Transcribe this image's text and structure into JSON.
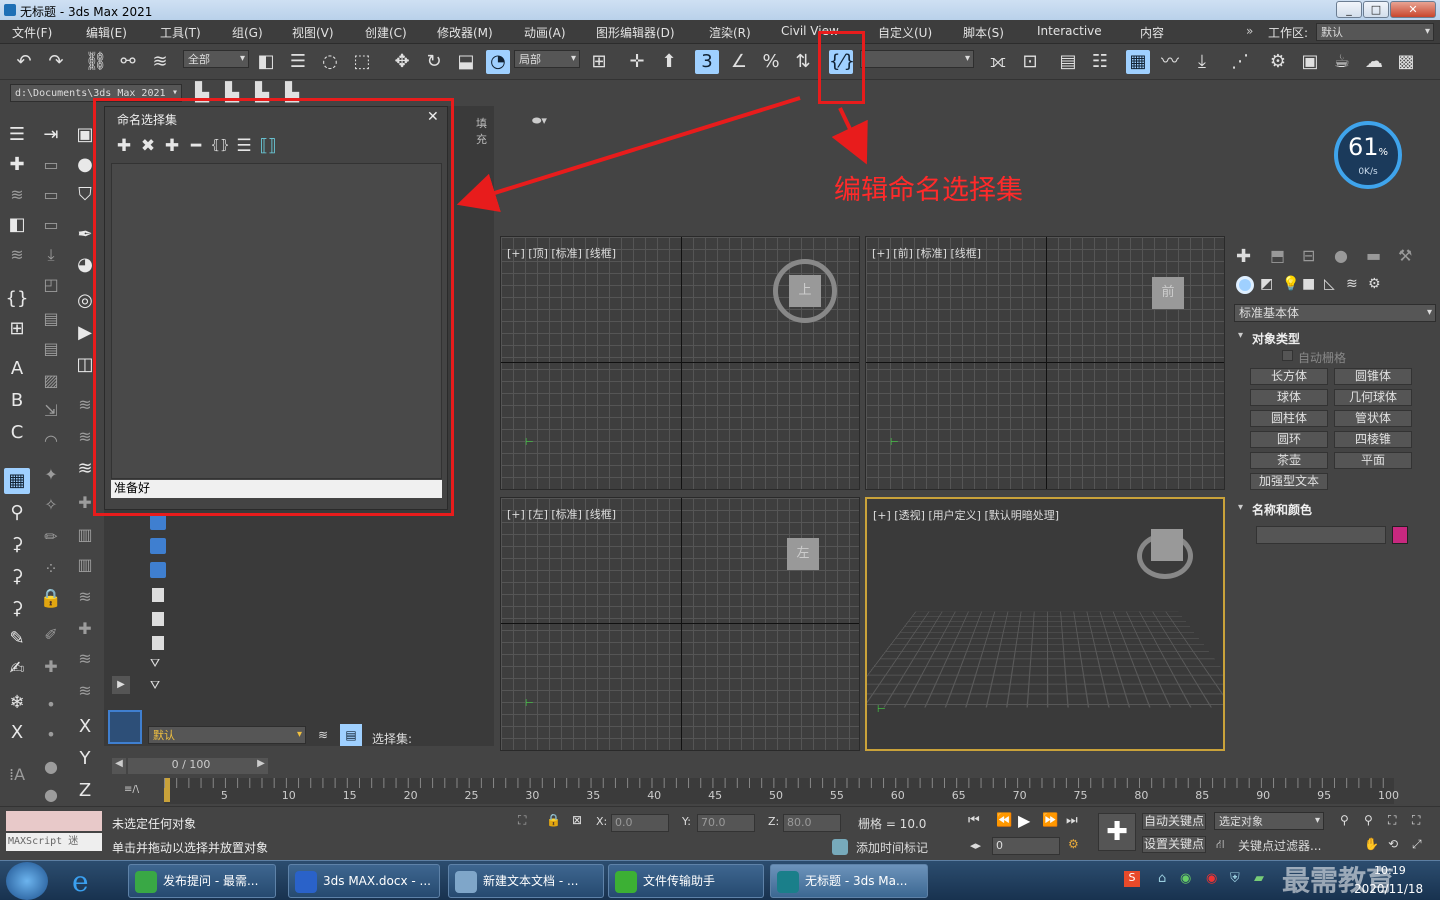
{
  "window": {
    "title": "无标题 - 3ds Max 2021",
    "controls": [
      "_",
      "□",
      "✕"
    ]
  },
  "menubar": {
    "items": [
      "文件(F)",
      "编辑(E)",
      "工具(T)",
      "组(G)",
      "视图(V)",
      "创建(C)",
      "修改器(M)",
      "动画(A)",
      "图形编辑器(D)",
      "渲染(R)",
      "Civil View",
      "自定义(U)",
      "脚本(S)",
      "Interactive",
      "内容"
    ],
    "workspace_label": "工作区:",
    "workspace_value": "默认"
  },
  "toolbar": {
    "selection_filter": "全部",
    "ref_coord": "局部"
  },
  "pathbar": {
    "path": "d:\\Documents\\3ds Max 2021"
  },
  "scene_explorer": {
    "tab_fill": "填充",
    "bottom_dropdown": "默认",
    "selection_set_label": "选择集:"
  },
  "dialog": {
    "title": "命名选择集",
    "close": "✕",
    "status": "准备好",
    "tools": [
      {
        "name": "create-new-set-icon",
        "glyph": "✚"
      },
      {
        "name": "remove-icon",
        "glyph": "✖"
      },
      {
        "name": "add-selected-icon",
        "glyph": "✚"
      },
      {
        "name": "subtract-selected-icon",
        "glyph": "━"
      },
      {
        "name": "select-objects-in-set-icon",
        "glyph": "⦃⦄"
      },
      {
        "name": "select-by-name-icon",
        "glyph": "☰"
      },
      {
        "name": "highlight-selected-icon",
        "glyph": "⟦⟧"
      }
    ]
  },
  "annotation": {
    "text": "编辑命名选择集"
  },
  "net_gauge": {
    "value": "61",
    "unit": "%",
    "speed": "0K/s"
  },
  "viewports": [
    {
      "label": "[+] [顶] [标准] [线框]",
      "cube": "上"
    },
    {
      "label": "[+] [前] [标准] [线框]",
      "cube": "前"
    },
    {
      "label": "[+] [左] [标准] [线框]",
      "cube": "左"
    },
    {
      "label": "[+] [透视] [用户定义] [默认明暗处理]",
      "cube": ""
    }
  ],
  "command_panel": {
    "category": "标准基本体",
    "object_type_title": "对象类型",
    "autogrid": "自动栅格",
    "buttons": [
      "长方体",
      "圆锥体",
      "球体",
      "几何球体",
      "圆柱体",
      "管状体",
      "圆环",
      "四棱锥",
      "茶壶",
      "平面",
      "加强型文本"
    ],
    "name_color_title": "名称和颜色",
    "object_color": "#c8287f"
  },
  "timeline": {
    "frame": "0 / 100",
    "ticks": [
      "5",
      "10",
      "15",
      "20",
      "25",
      "30",
      "35",
      "40",
      "45",
      "50",
      "55",
      "60",
      "65",
      "70",
      "75",
      "80",
      "85",
      "90",
      "95",
      "100"
    ]
  },
  "status": {
    "maxscript": "MAXScript 迷",
    "line1": "未选定任何对象",
    "line2": "单击并拖动以选择并放置对象",
    "x_label": "X:",
    "x": "0.0",
    "y_label": "Y:",
    "y": "70.0",
    "z_label": "Z:",
    "z": "80.0",
    "grid": "栅格 = 10.0",
    "add_time_tag": "添加时间标记",
    "auto_key": "自动关键点",
    "set_key": "设置关键点",
    "selected_object": "选定对象",
    "key_filter": "关键点过滤器...",
    "frame_field": "0"
  },
  "taskbar": {
    "tasks": [
      {
        "label": "发布提问 - 最需...",
        "color": "#39a845"
      },
      {
        "label": "3ds MAX.docx - ...",
        "color": "#2a62c9"
      },
      {
        "label": "新建文本文档 - ...",
        "color": "#7fa6c9"
      },
      {
        "label": "文件传输助手",
        "color": "#3cb034"
      },
      {
        "label": "无标题 - 3ds Ma...",
        "color": "#1a7f8a"
      }
    ],
    "time": "10:19",
    "date": "2020/11/18"
  },
  "watermark": "最需教育"
}
